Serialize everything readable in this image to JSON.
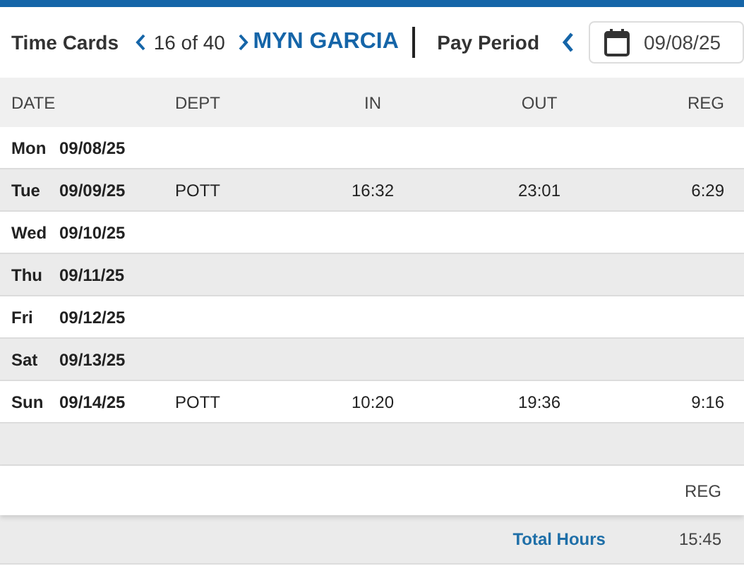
{
  "header": {
    "title": "Time Cards",
    "counter": "16 of 40",
    "employee": "MYN GARCIA",
    "pay_period_label": "Pay Period",
    "date_field": {
      "value": "09/08/25"
    }
  },
  "table": {
    "columns": [
      "DATE",
      "DEPT",
      "IN",
      "OUT",
      "REG"
    ],
    "rows": [
      {
        "day": "Mon",
        "date": "09/08/25"
      },
      {
        "day": "Tue",
        "date": "09/09/25",
        "dept": "POTT",
        "in": "16:32",
        "out": "23:01",
        "reg": "6:29"
      },
      {
        "day": "Wed",
        "date": "09/10/25"
      },
      {
        "day": "Thu",
        "date": "09/11/25"
      },
      {
        "day": "Fri",
        "date": "09/12/25"
      },
      {
        "day": "Sat",
        "date": "09/13/25"
      },
      {
        "day": "Sun",
        "date": "09/14/25",
        "dept": "POTT",
        "in": "10:20",
        "out": "19:36",
        "reg": "9:16"
      }
    ]
  },
  "summary": {
    "column": "REG",
    "label": "Total Hours",
    "value": "15:45"
  }
}
